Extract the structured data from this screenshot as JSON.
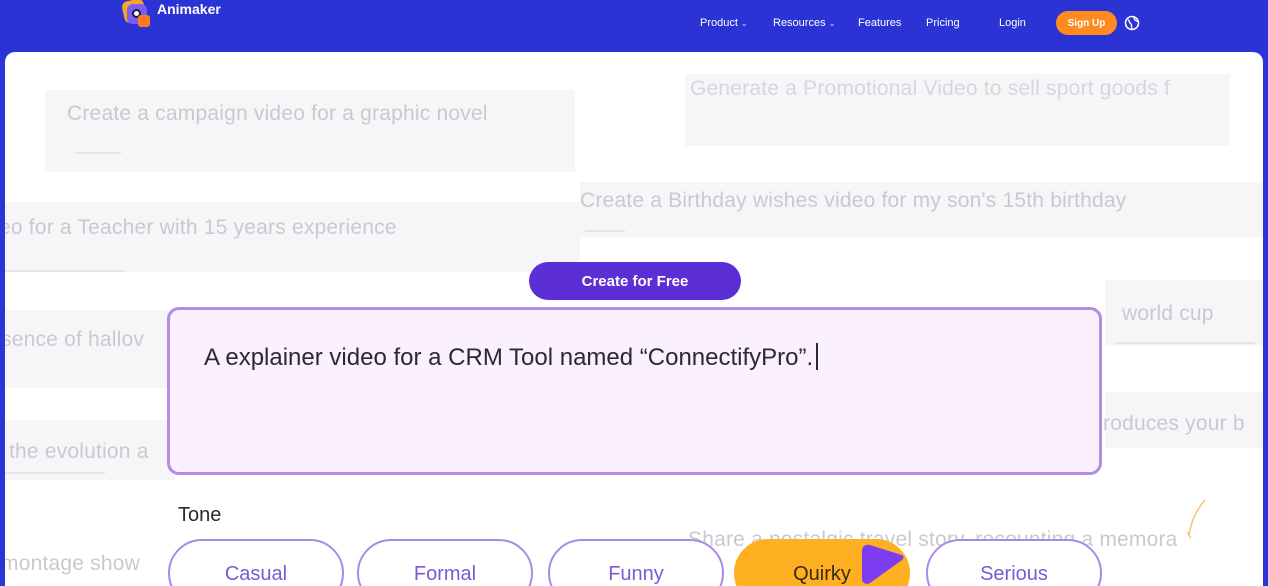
{
  "brand": {
    "name": "Animaker",
    "icon": "animaker-logo-icon"
  },
  "nav": {
    "product": "Product",
    "resources": "Resources",
    "features": "Features",
    "pricing": "Pricing",
    "login": "Login",
    "signup": "Sign Up",
    "language_icon": "globe-icon",
    "dropdown_icon": "chevron-down-icon"
  },
  "background_prompts": [
    "Create a campaign video for a graphic novel",
    "Generate a Promotional Video to sell sport goods f",
    "eo for a Teacher with 15 years experience",
    "Create a Birthday wishes video for my son's 15th birthday",
    "sence of hallov",
    "world cup",
    "the evolution a",
    "roduces your b",
    "montage show",
    "Share a nostalgic travel story, recounting a memora"
  ],
  "cta": {
    "label": "Create for Free"
  },
  "prompt": {
    "value": "A explainer video for a CRM Tool named “ConnectifyPro”."
  },
  "tone": {
    "label": "Tone",
    "options": [
      "Casual",
      "Formal",
      "Funny",
      "Quirky",
      "Serious"
    ],
    "selected": "Quirky"
  },
  "colors": {
    "nav_bg": "#2b33d4",
    "cta_bg": "#5b2ed6",
    "signup_bg": "#ff8a1f",
    "selected_chip": "#ffb022",
    "prompt_border": "#b28ce6"
  }
}
